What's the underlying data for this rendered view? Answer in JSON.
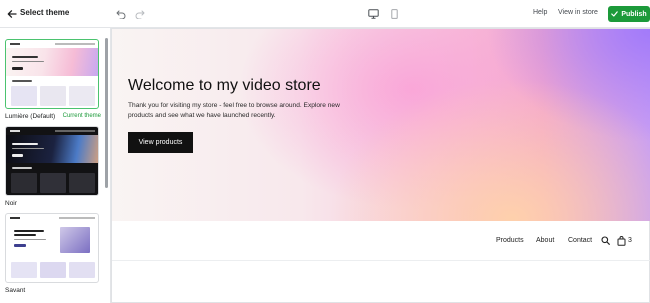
{
  "sidebar": {
    "title": "Select theme",
    "themes": [
      {
        "name": "Lumière (Default)",
        "status": "Current theme",
        "selected": true
      },
      {
        "name": "Noir",
        "selected": false
      },
      {
        "name": "Savant",
        "selected": false
      }
    ]
  },
  "toolbar": {
    "help_label": "Help",
    "view_store_label": "View in store",
    "publish_label": "Publish"
  },
  "preview": {
    "hero": {
      "title": "Welcome to my video store",
      "subtitle": "Thank you for visiting my store - feel free to browse around. Explore new products and see what we have launched recently.",
      "cta_label": "View products"
    },
    "nav": {
      "items": [
        "Products",
        "About",
        "Contact"
      ],
      "cart_count": "3"
    }
  },
  "colors": {
    "publish": "#1c9a3a",
    "current_theme": "#1c9a3a",
    "selected_border": "#4bc36f"
  }
}
